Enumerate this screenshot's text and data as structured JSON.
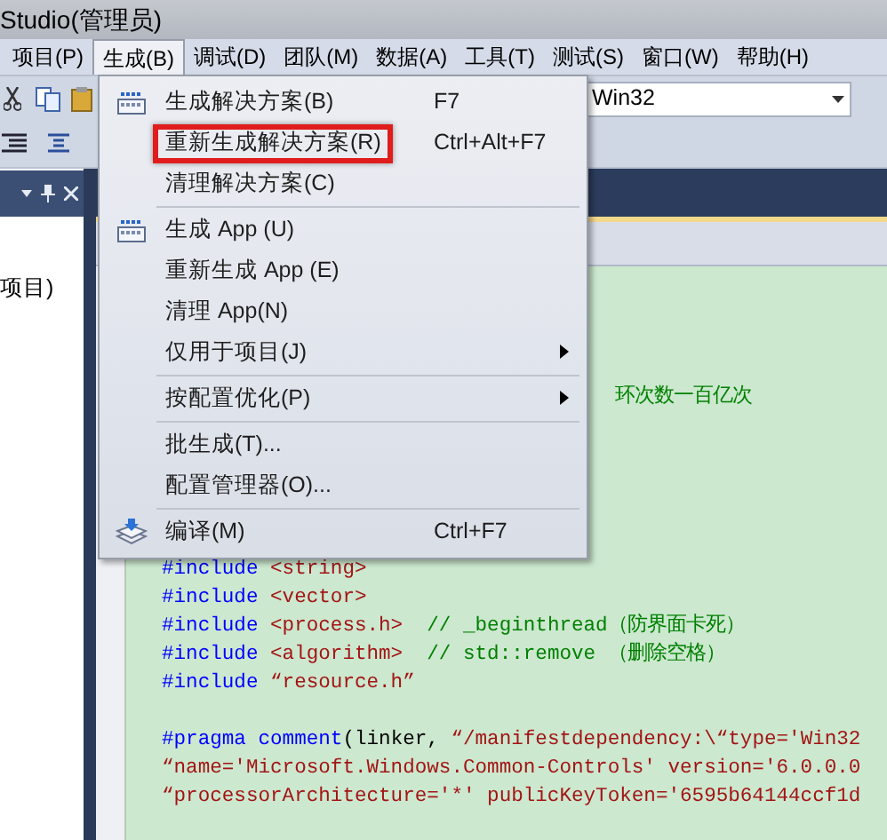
{
  "window": {
    "title": "Studio(管理员)"
  },
  "menubar": [
    {
      "label": "项目(P)",
      "selected": false
    },
    {
      "label": "生成(B)",
      "selected": true
    },
    {
      "label": "调试(D)",
      "selected": false
    },
    {
      "label": "团队(M)",
      "selected": false
    },
    {
      "label": "数据(A)",
      "selected": false
    },
    {
      "label": "工具(T)",
      "selected": false
    },
    {
      "label": "测试(S)",
      "selected": false
    },
    {
      "label": "窗口(W)",
      "selected": false
    },
    {
      "label": "帮助(H)",
      "selected": false
    }
  ],
  "toolbar": {
    "platform_combo": "Win32"
  },
  "solution_panel": {
    "item": "项目)"
  },
  "menu": {
    "groups": [
      {
        "items": [
          {
            "label": "生成解决方案(B)",
            "shortcut": "F7",
            "kind": "build",
            "submenu": false,
            "highlighted": false
          },
          {
            "label": "重新生成解决方案(R)",
            "shortcut": "Ctrl+Alt+F7",
            "kind": "plain",
            "submenu": false,
            "highlighted": true
          },
          {
            "label": "清理解决方案(C)",
            "kind": "plain",
            "submenu": false,
            "highlighted": false
          }
        ]
      },
      {
        "items": [
          {
            "label": "生成 App (U)",
            "kind": "build",
            "submenu": false,
            "highlighted": false
          },
          {
            "label": "重新生成 App (E)",
            "kind": "plain",
            "submenu": false,
            "highlighted": false
          },
          {
            "label": "清理 App(N)",
            "kind": "plain",
            "submenu": false,
            "highlighted": false
          },
          {
            "label": "仅用于项目(J)",
            "kind": "plain",
            "submenu": true,
            "highlighted": false
          }
        ]
      },
      {
        "items": [
          {
            "label": "按配置优化(P)",
            "kind": "plain",
            "submenu": true,
            "highlighted": false
          }
        ]
      },
      {
        "items": [
          {
            "label": "批生成(T)...",
            "kind": "plain",
            "submenu": false,
            "highlighted": false
          },
          {
            "label": "配置管理器(O)...",
            "kind": "plain",
            "submenu": false,
            "highlighted": false
          }
        ]
      },
      {
        "items": [
          {
            "label": "编译(M)",
            "shortcut": "Ctrl+F7",
            "kind": "compile",
            "submenu": false,
            "highlighted": false
          }
        ]
      }
    ]
  },
  "editor": {
    "visible_comment": "环次数一百亿次",
    "lines": [
      {
        "kind": "code",
        "tokens": [
          {
            "kind": "keyword",
            "text": "#include"
          },
          {
            "kind": "string",
            "text": " <string>"
          }
        ]
      },
      {
        "kind": "code",
        "tokens": [
          {
            "kind": "keyword",
            "text": "#include"
          },
          {
            "kind": "string",
            "text": " <vector>"
          }
        ]
      },
      {
        "kind": "code",
        "tokens": [
          {
            "kind": "keyword",
            "text": "#include"
          },
          {
            "kind": "string",
            "text": " <process.h>"
          },
          {
            "kind": "comment",
            "text": "  // _beginthread（防界面卡死）"
          }
        ]
      },
      {
        "kind": "code",
        "tokens": [
          {
            "kind": "keyword",
            "text": "#include"
          },
          {
            "kind": "string",
            "text": " <algorithm>"
          },
          {
            "kind": "comment",
            "text": "  // std::remove （删除空格）"
          }
        ]
      },
      {
        "kind": "code",
        "tokens": [
          {
            "kind": "keyword",
            "text": "#include"
          },
          {
            "kind": "string",
            "text": " “resource.h”"
          }
        ]
      },
      {
        "kind": "blank"
      },
      {
        "kind": "code",
        "tokens": [
          {
            "kind": "keyword",
            "text": "#pragma"
          },
          {
            "kind": "keyword",
            "text": " comment"
          },
          {
            "kind": "plain",
            "text": "(linker, "
          },
          {
            "kind": "string",
            "text": "“/manifestdependency:\\“type='Win32"
          }
        ]
      },
      {
        "kind": "code",
        "tokens": [
          {
            "kind": "string",
            "text": "“name='Microsoft.Windows.Common-Controls' version='6.0.0.0"
          }
        ]
      },
      {
        "kind": "code",
        "tokens": [
          {
            "kind": "string",
            "text": "“processorArchitecture='*' publicKeyToken='6595b64144ccf1d"
          }
        ]
      }
    ]
  }
}
